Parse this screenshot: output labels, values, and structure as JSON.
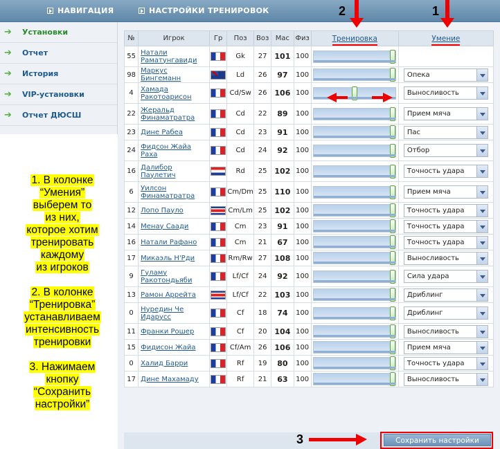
{
  "nav": {
    "title": "НАВИГАЦИЯ",
    "items": [
      {
        "label": "Установки",
        "active": true
      },
      {
        "label": "Отчет"
      },
      {
        "label": "История"
      },
      {
        "label": "VIP-установки"
      },
      {
        "label": "Отчет ДЮСШ"
      }
    ]
  },
  "instructions": {
    "p1": [
      "1. В колонке",
      "“Умения”",
      "выберем то",
      "из них,",
      "которое хотим",
      "тренировать",
      "каждому",
      "из игроков"
    ],
    "p2": [
      "2. В колонке",
      "“Тренировка”",
      "устанавливаем",
      "интенсивность",
      "тренировки"
    ],
    "p3": [
      "3. Нажимаем",
      "кнопку",
      "“Сохранить",
      "настройки”"
    ]
  },
  "panel": {
    "title": "НАСТРОЙКИ ТРЕНИРОВОК"
  },
  "columns": [
    "№",
    "Игрок",
    "Гр",
    "Поз",
    "Воз",
    "Мас",
    "Физ",
    "Тренировка",
    "Умение"
  ],
  "players": [
    {
      "num": "55",
      "name": [
        "Натали",
        "Раматунгавиди"
      ],
      "flag": "fr",
      "pos": "Gk",
      "age": "27",
      "mas": "101",
      "fiz": "100",
      "training": 1.0,
      "skill": ""
    },
    {
      "num": "98",
      "name": [
        "Маркус Бингеманн"
      ],
      "flag": "au",
      "pos": "Ld",
      "age": "26",
      "mas": "97",
      "fiz": "100",
      "training": 1.0,
      "skill": "Опека"
    },
    {
      "num": "4",
      "name": [
        "Хамада",
        "Ракотоарисон"
      ],
      "flag": "fr",
      "pos": "Cd/Sw",
      "age": "26",
      "mas": "106",
      "fiz": "100",
      "training": 0.5,
      "skill": "Выносливость"
    },
    {
      "num": "22",
      "name": [
        "Жеральд",
        "Финаматратра"
      ],
      "flag": "fr",
      "pos": "Cd",
      "age": "22",
      "mas": "89",
      "fiz": "100",
      "training": 1.0,
      "skill": "Прием мяча"
    },
    {
      "num": "23",
      "name": [
        "Дине Рабеа"
      ],
      "flag": "fr",
      "pos": "Cd",
      "age": "23",
      "mas": "91",
      "fiz": "100",
      "training": 1.0,
      "skill": "Пас"
    },
    {
      "num": "24",
      "name": [
        "Фидсон Жайа",
        "Раха"
      ],
      "flag": "fr",
      "pos": "Cd",
      "age": "24",
      "mas": "92",
      "fiz": "100",
      "training": 1.0,
      "skill": "Отбор"
    },
    {
      "num": "16",
      "name": [
        "Далибор",
        "Паулетич"
      ],
      "flag": "hr",
      "pos": "Rd",
      "age": "25",
      "mas": "102",
      "fiz": "100",
      "training": 1.0,
      "skill": "Точность удара"
    },
    {
      "num": "6",
      "name": [
        "Уилсон",
        "Финаматратра"
      ],
      "flag": "fr",
      "pos": "Cm/Dm",
      "age": "25",
      "mas": "110",
      "fiz": "100",
      "training": 1.0,
      "skill": "Прием мяча"
    },
    {
      "num": "12",
      "name": [
        "Лопо Пауло"
      ],
      "flag": "cr",
      "pos": "Cm/Lm",
      "age": "25",
      "mas": "102",
      "fiz": "100",
      "training": 1.0,
      "skill": "Точность удара"
    },
    {
      "num": "14",
      "name": [
        "Менау Саади"
      ],
      "flag": "fr",
      "pos": "Cm",
      "age": "23",
      "mas": "91",
      "fiz": "100",
      "training": 1.0,
      "skill": "Точность удара"
    },
    {
      "num": "16",
      "name": [
        "Натали Рафано"
      ],
      "flag": "fr",
      "pos": "Cm",
      "age": "21",
      "mas": "67",
      "fiz": "100",
      "training": 1.0,
      "skill": "Точность удара"
    },
    {
      "num": "17",
      "name": [
        "Микаэль Н'Рди"
      ],
      "flag": "fr",
      "pos": "Rm/Rw",
      "age": "27",
      "mas": "108",
      "fiz": "100",
      "training": 1.0,
      "skill": "Выносливость"
    },
    {
      "num": "9",
      "name": [
        "Гуламу",
        "Ракотондьяби"
      ],
      "flag": "fr",
      "pos": "Lf/Cf",
      "age": "24",
      "mas": "92",
      "fiz": "100",
      "training": 1.0,
      "skill": "Сила удара"
    },
    {
      "num": "13",
      "name": [
        "Рамон Аррейта"
      ],
      "flag": "cr",
      "pos": "Lf/Cf",
      "age": "22",
      "mas": "103",
      "fiz": "100",
      "training": 1.0,
      "skill": "Дриблинг"
    },
    {
      "num": "0",
      "name": [
        "Нурeдин Че",
        "Идарусс"
      ],
      "flag": "fr",
      "pos": "Cf",
      "age": "18",
      "mas": "74",
      "fiz": "100",
      "training": 1.0,
      "skill": "Дриблинг"
    },
    {
      "num": "11",
      "name": [
        "Франки Рошер"
      ],
      "flag": "fr",
      "pos": "Cf",
      "age": "20",
      "mas": "104",
      "fiz": "100",
      "training": 1.0,
      "skill": "Выносливость"
    },
    {
      "num": "15",
      "name": [
        "Фидисон Жайа"
      ],
      "flag": "fr",
      "pos": "Cf/Am",
      "age": "26",
      "mas": "106",
      "fiz": "100",
      "training": 1.0,
      "skill": "Прием мяча"
    },
    {
      "num": "0",
      "name": [
        "Халид Барри"
      ],
      "flag": "fr",
      "pos": "Rf",
      "age": "19",
      "mas": "80",
      "fiz": "100",
      "training": 1.0,
      "skill": "Точность удара"
    },
    {
      "num": "17",
      "name": [
        "Дине Махамаду"
      ],
      "flag": "fr",
      "pos": "Rf",
      "age": "21",
      "mas": "63",
      "fiz": "100",
      "training": 1.0,
      "skill": "Выносливость"
    }
  ],
  "save_label": "Сохранить настройки",
  "annotations": {
    "one": "1",
    "two": "2",
    "three": "3"
  }
}
